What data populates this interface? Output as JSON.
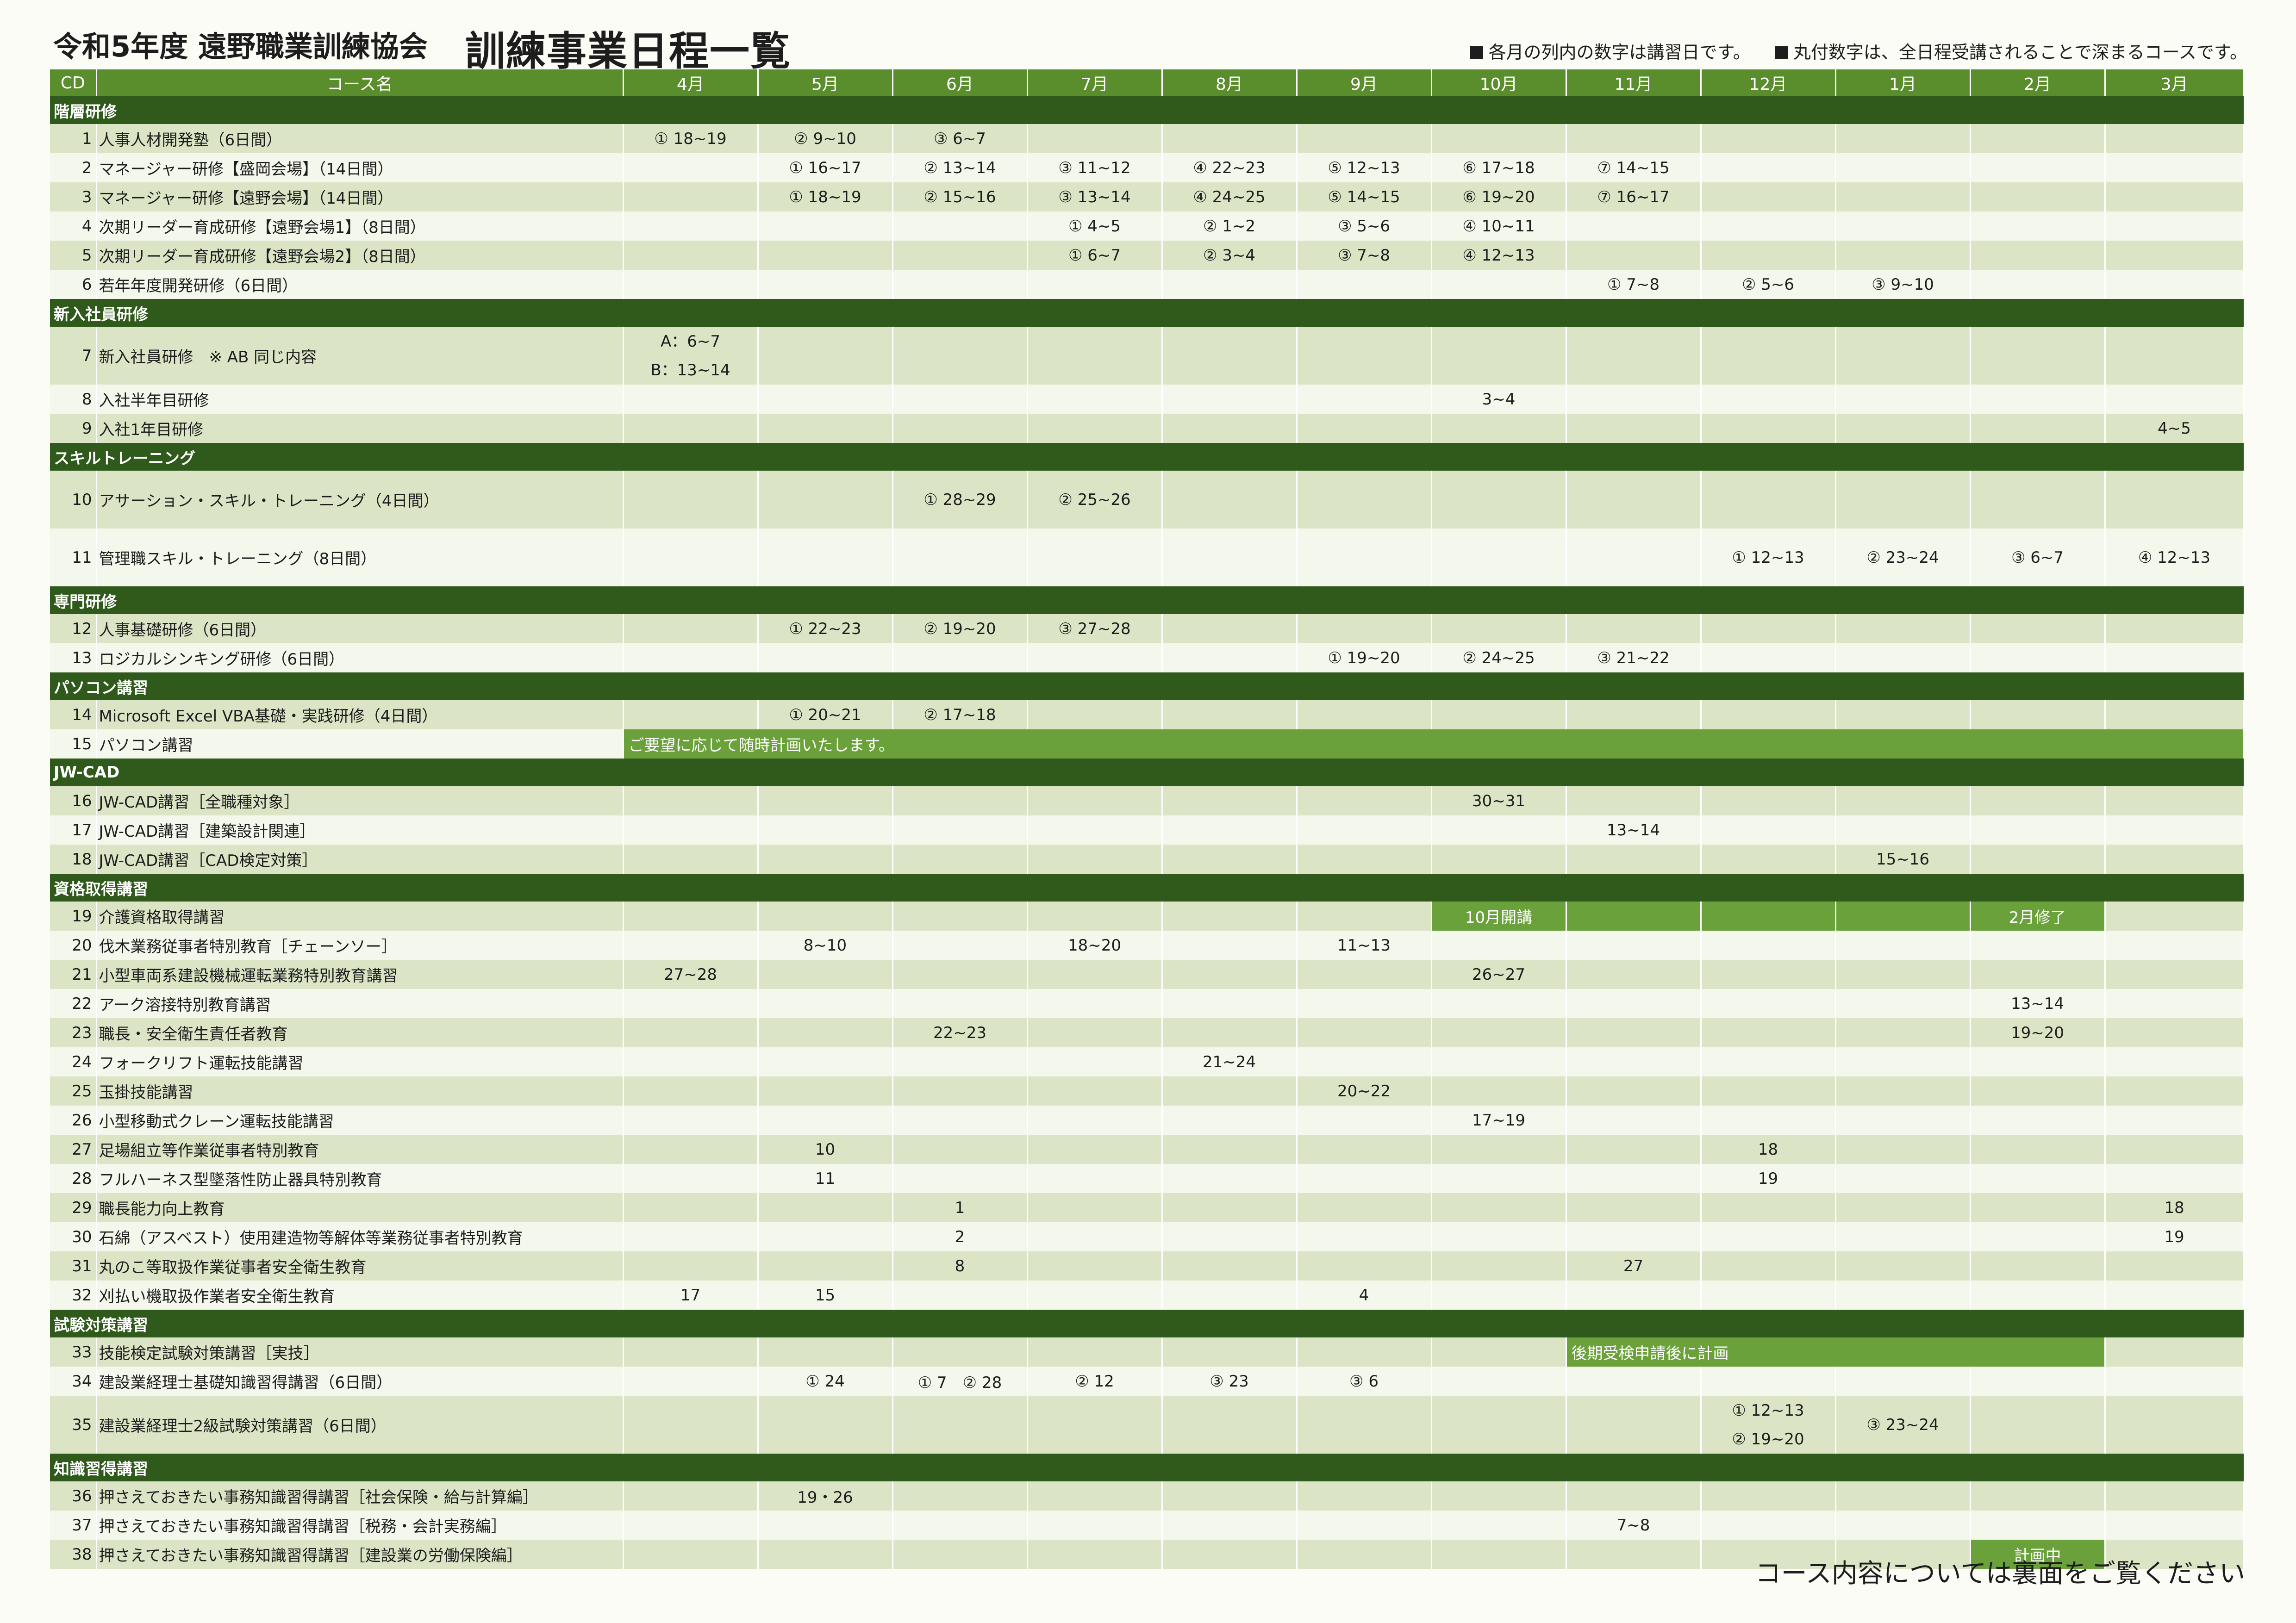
{
  "header": {
    "subtitle": "令和5年度 遠野職業訓練協会",
    "title": "訓練事業日程一覧",
    "note1": "各月の列内の数字は講習日です。",
    "note2": "丸付数字は、全日程受講されることで深まるコースです。"
  },
  "columns": {
    "cd": "CD",
    "name": "コース名",
    "months": [
      "4月",
      "5月",
      "6月",
      "7月",
      "8月",
      "9月",
      "10月",
      "11月",
      "12月",
      "1月",
      "2月",
      "3月"
    ]
  },
  "sections": [
    {
      "name": "階層研修",
      "rows": [
        {
          "cd": "1",
          "name": "人事人材開発塾（6日間）",
          "m": {
            "0": "① 18~19",
            "1": "② 9~10",
            "2": "③ 6~7"
          }
        },
        {
          "cd": "2",
          "name": "マネージャー研修【盛岡会場】（14日間）",
          "m": {
            "1": "① 16~17",
            "2": "② 13~14",
            "3": "③ 11~12",
            "4": "④ 22~23",
            "5": "⑤ 12~13",
            "6": "⑥ 17~18",
            "7": "⑦ 14~15"
          }
        },
        {
          "cd": "3",
          "name": "マネージャー研修【遠野会場】（14日間）",
          "m": {
            "1": "① 18~19",
            "2": "② 15~16",
            "3": "③ 13~14",
            "4": "④ 24~25",
            "5": "⑤ 14~15",
            "6": "⑥ 19~20",
            "7": "⑦ 16~17"
          }
        },
        {
          "cd": "4",
          "name": "次期リーダー育成研修【遠野会場1】（8日間）",
          "m": {
            "3": "① 4~5",
            "4": "② 1~2",
            "5": "③ 5~6",
            "6": "④ 10~11"
          }
        },
        {
          "cd": "5",
          "name": "次期リーダー育成研修【遠野会場2】（8日間）",
          "m": {
            "3": "① 6~7",
            "4": "② 3~4",
            "5": "③ 7~8",
            "6": "④ 12~13"
          }
        },
        {
          "cd": "6",
          "name": "若年年度開発研修（6日間）",
          "m": {
            "7": "① 7~8",
            "8": "② 5~6",
            "9": "③ 9~10"
          }
        }
      ]
    },
    {
      "name": "新入社員研修",
      "rows": [
        {
          "cd": "7",
          "name": "新入社員研修　※ AB 同じ内容",
          "m": {
            "0": "A：6~7\nB：13~14"
          },
          "tall": true
        },
        {
          "cd": "8",
          "name": "入社半年目研修",
          "m": {
            "6": "3~4"
          }
        },
        {
          "cd": "9",
          "name": "入社1年目研修",
          "m": {
            "11": "4~5"
          }
        }
      ]
    },
    {
      "name": "スキルトレーニング",
      "rows": [
        {
          "cd": "10",
          "name": "アサーション・スキル・トレーニング（4日間）",
          "m": {
            "2": "① 28~29",
            "3": "② 25~26"
          },
          "tall": true
        },
        {
          "cd": "11",
          "name": "管理職スキル・トレーニング（8日間）",
          "m": {
            "8": "① 12~13",
            "9": "② 23~24",
            "10": "③ 6~7",
            "11": "④ 12~13"
          },
          "tall": true
        }
      ]
    },
    {
      "name": "専門研修",
      "rows": [
        {
          "cd": "12",
          "name": "人事基礎研修（6日間）",
          "m": {
            "1": "① 22~23",
            "2": "② 19~20",
            "3": "③ 27~28"
          }
        },
        {
          "cd": "13",
          "name": "ロジカルシンキング研修（6日間）",
          "m": {
            "5": "① 19~20",
            "6": "② 24~25",
            "7": "③ 21~22"
          }
        }
      ]
    },
    {
      "name": "パソコン講習",
      "rows": [
        {
          "cd": "14",
          "name": "Microsoft Excel VBA基礎・実践研修（4日間）",
          "m": {
            "1": "① 20~21",
            "2": "② 17~18"
          }
        },
        {
          "cd": "15",
          "name": "パソコン講習",
          "span": {
            "start": 0,
            "len": 12,
            "text": "ご要望に応じて随時計画いたします。"
          }
        }
      ]
    },
    {
      "name": "JW-CAD",
      "rows": [
        {
          "cd": "16",
          "name": "JW-CAD講習［全職種対象］",
          "m": {
            "6": "30~31"
          }
        },
        {
          "cd": "17",
          "name": "JW-CAD講習［建築設計関連］",
          "m": {
            "7": "13~14"
          }
        },
        {
          "cd": "18",
          "name": "JW-CAD講習［CAD検定対策］",
          "m": {
            "9": "15~16"
          }
        }
      ]
    },
    {
      "name": "資格取得講習",
      "rows": [
        {
          "cd": "19",
          "name": "介護資格取得講習",
          "hl": {
            "6": "10月開講",
            "7": "",
            "8": "",
            "9": "",
            "10": "2月修了"
          }
        },
        {
          "cd": "20",
          "name": "伐木業務従事者特別教育［チェーンソー］",
          "m": {
            "1": "8~10",
            "3": "18~20",
            "5": "11~13"
          }
        },
        {
          "cd": "21",
          "name": "小型車両系建設機械運転業務特別教育講習",
          "m": {
            "0": "27~28",
            "6": "26~27"
          }
        },
        {
          "cd": "22",
          "name": "アーク溶接特別教育講習",
          "m": {
            "10": "13~14"
          }
        },
        {
          "cd": "23",
          "name": "職長・安全衛生責任者教育",
          "m": {
            "2": "22~23",
            "10": "19~20"
          }
        },
        {
          "cd": "24",
          "name": "フォークリフト運転技能講習",
          "m": {
            "4": "21~24"
          }
        },
        {
          "cd": "25",
          "name": "玉掛技能講習",
          "m": {
            "5": "20~22"
          }
        },
        {
          "cd": "26",
          "name": "小型移動式クレーン運転技能講習",
          "m": {
            "6": "17~19"
          }
        },
        {
          "cd": "27",
          "name": "足場組立等作業従事者特別教育",
          "m": {
            "1": "10",
            "8": "18"
          }
        },
        {
          "cd": "28",
          "name": "フルハーネス型墜落性防止器具特別教育",
          "m": {
            "1": "11",
            "8": "19"
          }
        },
        {
          "cd": "29",
          "name": "職長能力向上教育",
          "m": {
            "2": "1",
            "11": "18"
          }
        },
        {
          "cd": "30",
          "name": "石綿（アスベスト）使用建造物等解体等業務従事者特別教育",
          "m": {
            "2": "2",
            "11": "19"
          }
        },
        {
          "cd": "31",
          "name": "丸のこ等取扱作業従事者安全衛生教育",
          "m": {
            "2": "8",
            "7": "27"
          }
        },
        {
          "cd": "32",
          "name": "刈払い機取扱作業者安全衛生教育",
          "m": {
            "0": "17",
            "1": "15",
            "5": "4"
          }
        }
      ]
    },
    {
      "name": "試験対策講習",
      "rows": [
        {
          "cd": "33",
          "name": "技能検定試験対策講習［実技］",
          "span": {
            "start": 7,
            "len": 4,
            "text": "後期受検申請後に計画"
          }
        },
        {
          "cd": "34",
          "name": "建設業経理士基礎知識習得講習（6日間）",
          "m": {
            "1": "① 24",
            "2": "① 7　② 28",
            "3": "② 12",
            "4": "③ 23",
            "5": "③ 6"
          }
        },
        {
          "cd": "35",
          "name": "建設業経理士2級試験対策講習（6日間）",
          "m": {
            "8": "① 12~13\n② 19~20",
            "9": "③ 23~24"
          },
          "tall": true
        }
      ]
    },
    {
      "name": "知識習得講習",
      "rows": [
        {
          "cd": "36",
          "name": "押さえておきたい事務知識習得講習［社会保険・給与計算編］",
          "m": {
            "1": "19・26"
          }
        },
        {
          "cd": "37",
          "name": "押さえておきたい事務知識習得講習［税務・会計実務編］",
          "m": {
            "7": "7~8"
          }
        },
        {
          "cd": "38",
          "name": "押さえておきたい事務知識習得講習［建設業の労働保険編］",
          "hl": {
            "10": "計画中"
          }
        }
      ]
    }
  ],
  "footer": "コース内容については裏面をご覧ください",
  "colors": {
    "header_green": "#5a8d2c",
    "category_green": "#2f5a1c",
    "highlight_green": "#6aa13a",
    "row_alt": "#dbe5c6"
  }
}
